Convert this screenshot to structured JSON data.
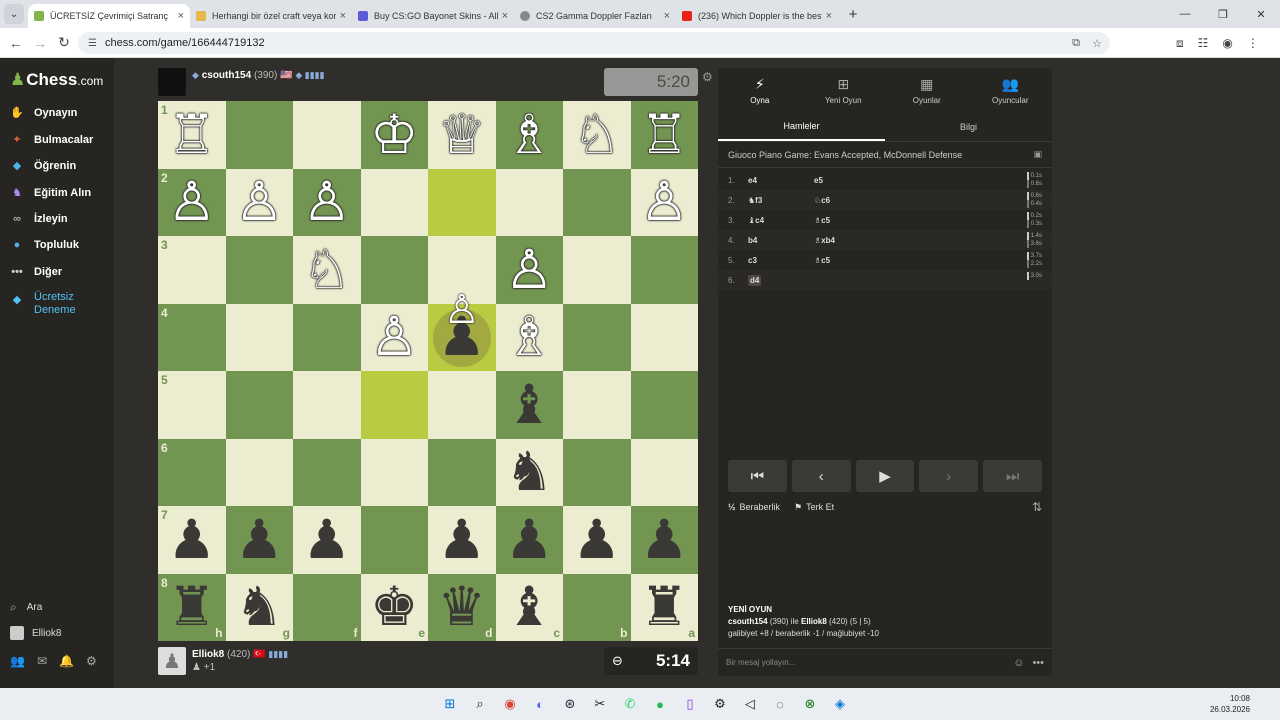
{
  "browser": {
    "tabs": [
      {
        "title": "ÜCRETSİZ Çevrimiçi Satranç",
        "favicon_color": "#81b64c",
        "active": true
      },
      {
        "title": "Herhangi bir özel craft veya kor",
        "favicon_color": "#e8b64a",
        "active": false
      },
      {
        "title": "Buy CS:GO Bayonet Skins - All",
        "favicon_color": "#5b5bd6",
        "active": false
      },
      {
        "title": "CS2 Gamma Doppler Fazları",
        "favicon_color": "#888888",
        "active": false
      },
      {
        "title": "(236) Which Doppler is the best",
        "favicon_color": "#e62117",
        "active": false
      }
    ],
    "url": "chess.com/game/166444719132"
  },
  "sidebar": {
    "logo": "Chess",
    "logo_suffix": ".com",
    "items": [
      {
        "label": "Oynayın",
        "icon": "play-hand-icon",
        "color": "#e8a96b"
      },
      {
        "label": "Bulmacalar",
        "icon": "puzzle-icon",
        "color": "#e0623c"
      },
      {
        "label": "Öğrenin",
        "icon": "graduation-cap-icon",
        "color": "#4fb0e6"
      },
      {
        "label": "Eğitim Alın",
        "icon": "coach-icon",
        "color": "#b28cf0"
      },
      {
        "label": "İzleyin",
        "icon": "binoculars-icon",
        "color": "#aaaaaa"
      },
      {
        "label": "Topluluk",
        "icon": "community-icon",
        "color": "#4fb0e6"
      },
      {
        "label": "Diğer",
        "icon": "more-dots-icon",
        "color": "#cccccc"
      },
      {
        "label": "Ücretsiz Deneme",
        "icon": "diamond-icon",
        "color": "#4fc3f7"
      }
    ],
    "search_label": "Ara",
    "user_name": "Elliok8"
  },
  "top_player": {
    "name": "csouth154",
    "rating": "(390)",
    "flag": "🇺🇸",
    "clock": "5:20"
  },
  "bottom_player": {
    "name": "Elliok8",
    "rating": "(420)",
    "flag": "🇹🇷",
    "extra": "+1",
    "clock": "5:14"
  },
  "board": {
    "rows": [
      [
        "♖",
        "",
        "",
        "♔",
        "♕",
        "♗",
        "♘",
        "♖"
      ],
      [
        "♙",
        "♙",
        "♙",
        "",
        "",
        "",
        "",
        "♙"
      ],
      [
        "",
        "",
        "♘",
        "",
        "",
        "♙",
        "",
        ""
      ],
      [
        "",
        "",
        "",
        "♙",
        "♟",
        "♗",
        "",
        ""
      ],
      [
        "",
        "",
        "",
        "",
        "",
        "♝",
        "",
        ""
      ],
      [
        "",
        "",
        "",
        "",
        "",
        "♞",
        "",
        ""
      ],
      [
        "♟",
        "♟",
        "♟",
        "",
        "♟",
        "♟",
        "♟",
        "♟"
      ],
      [
        "♜",
        "♞",
        "",
        "♚",
        "♛",
        "♝",
        "",
        "♜"
      ]
    ],
    "colors": [
      [
        "w",
        "",
        "",
        "w",
        "w",
        "w",
        "w",
        "w"
      ],
      [
        "w",
        "w",
        "w",
        "",
        "",
        "",
        "",
        "w"
      ],
      [
        "",
        "",
        "w",
        "",
        "",
        "w",
        "",
        ""
      ],
      [
        "",
        "",
        "",
        "w",
        "b",
        "w",
        "",
        ""
      ],
      [
        "",
        "",
        "",
        "",
        "",
        "b",
        "",
        ""
      ],
      [
        "",
        "",
        "",
        "",
        "",
        "b",
        "",
        ""
      ],
      [
        "b",
        "b",
        "b",
        "",
        "b",
        "b",
        "b",
        "b"
      ],
      [
        "b",
        "b",
        "",
        "b",
        "b",
        "b",
        "",
        "b"
      ]
    ],
    "ranks": [
      "1",
      "2",
      "3",
      "4",
      "5",
      "6",
      "7",
      "8"
    ],
    "files": [
      "h",
      "g",
      "f",
      "e",
      "d",
      "c",
      "b",
      "a"
    ]
  },
  "panel": {
    "tabs": [
      {
        "label": "Oyna",
        "icon": "lightning-icon"
      },
      {
        "label": "Yeni Oyun",
        "icon": "plus-square-icon"
      },
      {
        "label": "Oyunlar",
        "icon": "grid-icon"
      },
      {
        "label": "Oyuncular",
        "icon": "players-icon"
      }
    ],
    "subtabs": [
      "Hamleler",
      "Bilgi"
    ],
    "opening": "Giuoco Piano Game: Evans Accepted, McDonnell Defense",
    "moves": [
      {
        "no": "1.",
        "w": "e4",
        "b": "e5",
        "tw": "0.1s",
        "tb": "0.6s"
      },
      {
        "no": "2.",
        "w": "♞f3",
        "b": "♘c6",
        "tw": "0.6s",
        "tb": "0.4s"
      },
      {
        "no": "3.",
        "w": "♝c4",
        "b": "♗c5",
        "tw": "0.2s",
        "tb": "0.3s"
      },
      {
        "no": "4.",
        "w": "b4",
        "b": "♗xb4",
        "tw": "1.4s",
        "tb": "3.6s"
      },
      {
        "no": "5.",
        "w": "c3",
        "b": "♗c5",
        "tw": "3.7s",
        "tb": "2.2s"
      },
      {
        "no": "6.",
        "w": "d4",
        "b": "",
        "tw": "3.0s",
        "tb": ""
      }
    ],
    "draw_label": "Beraberlik",
    "resign_label": "Terk Et",
    "new_game_heading": "YENİ OYUN",
    "new_game_p1": "csouth154",
    "new_game_p1_rating": "(390)",
    "new_game_join": "ile",
    "new_game_p2": "Elliok8",
    "new_game_p2_rating": "(420) (5 | 5)",
    "new_game_stats": "galibiyet +8 / beraberlik -1 / mağlubiyet -10",
    "chat_placeholder": "Bir mesaj yollayın..."
  },
  "taskbar": {
    "time": "10:08",
    "date": "26.03.2026"
  }
}
